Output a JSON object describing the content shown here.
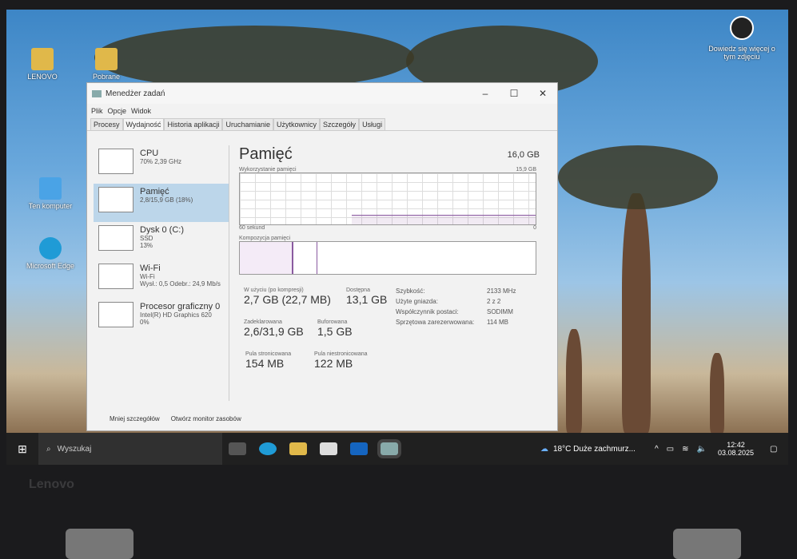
{
  "desktop": {
    "icons": [
      "LENOVO",
      "Pobrane",
      "Ten komputer",
      "Microsoft Edge"
    ],
    "learn_more": "Dowiedz się więcej o tym zdjęciu"
  },
  "window": {
    "title": "Menedżer zadań",
    "controls": [
      "–",
      "☐",
      "✕"
    ],
    "menu": [
      "Plik",
      "Opcje",
      "Widok"
    ],
    "tabs": [
      "Procesy",
      "Wydajność",
      "Historia aplikacji",
      "Uruchamianie",
      "Użytkownicy",
      "Szczegóły",
      "Usługi"
    ],
    "sidebar": [
      {
        "title": "CPU",
        "sub": "70% 2,39 GHz"
      },
      {
        "title": "Pamięć",
        "sub": "2,8/15,9 GB (18%)"
      },
      {
        "title": "Dysk 0 (C:)",
        "sub": "SSD",
        "sub2": "13%"
      },
      {
        "title": "Wi-Fi",
        "sub": "Wi-Fi",
        "sub2": "Wysł.: 0,5 Odebr.: 24,9 Mb/s"
      },
      {
        "title": "Procesor graficzny 0",
        "sub": "Intel(R) HD Graphics 620",
        "sub2": "0%"
      }
    ],
    "main": {
      "title": "Pamięć",
      "total": "16,0 GB",
      "usage_label": "Wykorzystanie pamięci",
      "usage_max": "15,9 GB",
      "time_label": "60 sekund",
      "zero": "0",
      "composition_label": "Kompozycja pamięci",
      "usage_percent": 18,
      "stats": {
        "in_use_label": "W użyciu (po kompresji)",
        "in_use": "2,7 GB (22,7 MB)",
        "available_label": "Dostępna",
        "available": "13,1 GB",
        "committed_label": "Zadeklarowana",
        "committed": "2,6/31,9 GB",
        "cached_label": "Buforowana",
        "cached": "1,5 GB",
        "paged_label": "Pula stronicowana",
        "paged": "154 MB",
        "nonpaged_label": "Pula niestronicowana",
        "nonpaged": "122 MB"
      },
      "specs": [
        {
          "k": "Szybkość:",
          "v": "2133 MHz"
        },
        {
          "k": "Użyte gniazda:",
          "v": "2 z 2"
        },
        {
          "k": "Współczynnik postaci:",
          "v": "SODIMM"
        },
        {
          "k": "Sprzętowa zarezerwowana:",
          "v": "114 MB"
        }
      ]
    },
    "footer": {
      "less": "Mniej szczegółów",
      "monitor": "Otwórz monitor zasobów"
    }
  },
  "taskbar": {
    "search": "Wyszukaj",
    "weather": "18°C  Duże zachmurz...",
    "time": "12:42",
    "date": "03.08.2025"
  },
  "bezel": {
    "brand": "Lenovo"
  }
}
